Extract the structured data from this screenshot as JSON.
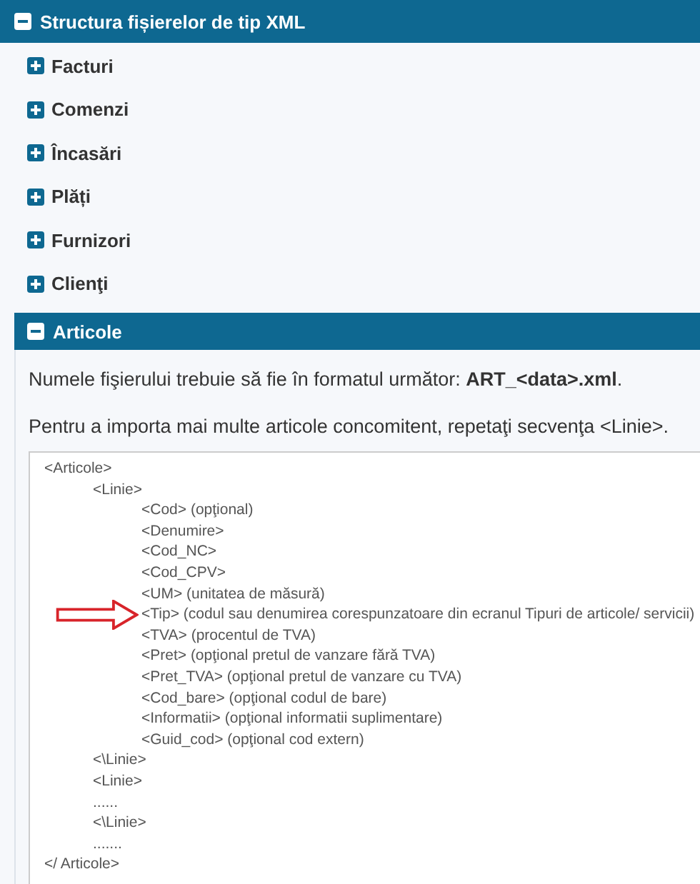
{
  "header": {
    "title": "Structura fișierelor de tip XML",
    "expanded": true
  },
  "sections": [
    {
      "title": "Facturi",
      "expanded": false
    },
    {
      "title": "Comenzi",
      "expanded": false
    },
    {
      "title": "Încasări",
      "expanded": false
    },
    {
      "title": "Plăți",
      "expanded": false
    },
    {
      "title": "Furnizori",
      "expanded": false
    },
    {
      "title": "Clienţi",
      "expanded": false
    },
    {
      "title": "Articole",
      "expanded": true,
      "paragraphs": [
        "Numele fişierului trebuie să fie în formatul următor: **ART_<data>.xml**.",
        "Pentru a importa mai multe articole concomitent, repetaţi secvenţa <Linie>."
      ],
      "code": [
        {
          "text": "<Articole>",
          "children": [
            {
              "text": "<Linie>",
              "children": [
                {
                  "text": "<Cod> (opţional)"
                },
                {
                  "text": "<Denumire>"
                },
                {
                  "text": "<Cod_NC>"
                },
                {
                  "text": "<Cod_CPV>"
                },
                {
                  "text": "<UM> (unitatea de măsură)"
                },
                {
                  "text": "<Tip> (codul sau denumirea corespunzatoare din ecranul Tipuri de articole/ servicii)",
                  "arrow": true
                },
                {
                  "text": "<TVA> (procentul de TVA)"
                },
                {
                  "text": "<Pret> (opţional pretul de vanzare fără TVA)"
                },
                {
                  "text": "<Pret_TVA> (opţional pretul de vanzare cu TVA)"
                },
                {
                  "text": "<Cod_bare> (opţional codul de bare)"
                },
                {
                  "text": "<Informatii> (opţional informatii suplimentare)"
                },
                {
                  "text": "<Guid_cod> (opţional cod extern)"
                }
              ]
            },
            {
              "text": "<\\Linie>"
            },
            {
              "text": "<Linie>"
            },
            {
              "text": "......"
            },
            {
              "text": "<\\Linie>"
            },
            {
              "text": "......."
            }
          ]
        },
        {
          "text": "</ Articole>"
        }
      ]
    }
  ]
}
